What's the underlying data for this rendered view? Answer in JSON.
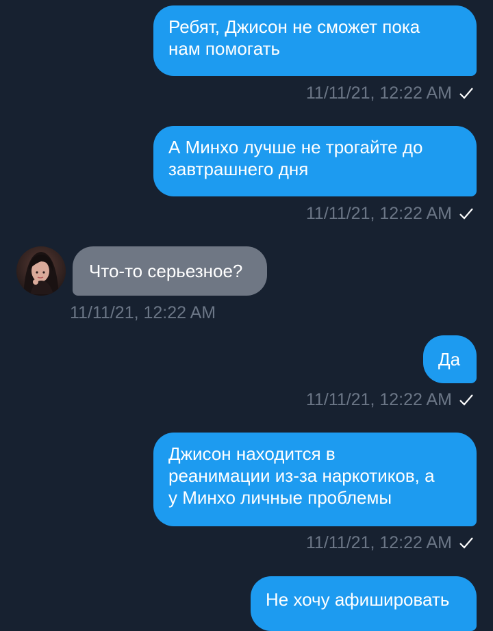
{
  "conversation": {
    "messages": [
      {
        "direction": "outgoing",
        "text": "Ребят, Джисон не сможет пока\nнам помогать",
        "timestamp": "11/11/21, 12:22 AM",
        "status_icon": "check-icon"
      },
      {
        "direction": "outgoing",
        "text": "А Минхо лучше не трогайте до\nзавтрашнего дня",
        "timestamp": "11/11/21, 12:22 AM",
        "status_icon": "check-icon"
      },
      {
        "direction": "incoming",
        "text": "Что-то серьезное?",
        "timestamp": "11/11/21, 12:22 AM",
        "avatar_icon": "user-avatar-photo"
      },
      {
        "direction": "outgoing",
        "text": "Да",
        "timestamp": "11/11/21, 12:22 AM",
        "status_icon": "check-icon"
      },
      {
        "direction": "outgoing",
        "text": "Джисон находится в\nреанимации из-за наркотиков, а\nу Минхо личные проблемы",
        "timestamp": "11/11/21, 12:22 AM",
        "status_icon": "check-icon"
      },
      {
        "direction": "outgoing",
        "text": "Не хочу афишировать",
        "timestamp": "",
        "status_icon": ""
      }
    ]
  },
  "colors": {
    "background": "#172130",
    "outgoing_bubble": "#1d9bf0",
    "incoming_bubble": "#6f7784",
    "timestamp_text": "#6b7686"
  }
}
